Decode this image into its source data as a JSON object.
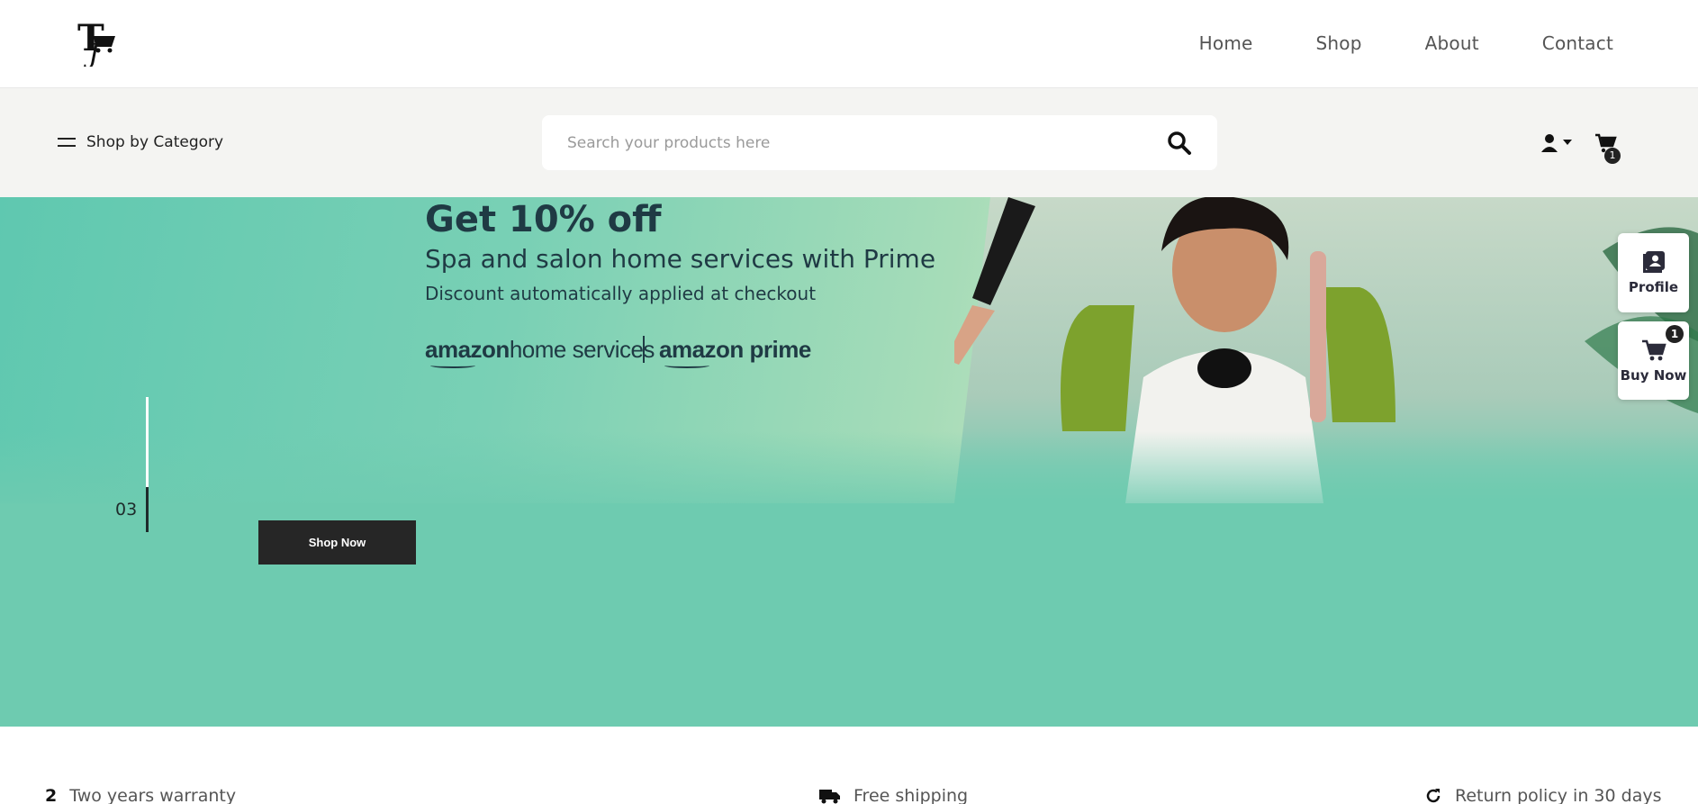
{
  "nav": {
    "logo_alt": "TJ",
    "links": [
      "Home",
      "Shop",
      "About",
      "Contact"
    ]
  },
  "toolbar": {
    "category_label": "Shop by Category",
    "search_placeholder": "Search your products here",
    "cart_count": "1"
  },
  "hero": {
    "title": "Get 10% off",
    "subtitle": "Spa and salon home services with Prime",
    "note": "Discount automatically applied at checkout",
    "brand_left_a": "amazon",
    "brand_left_b": "home services",
    "brand_right_a": "amazon",
    "brand_right_b": "prime",
    "slide_number": "03",
    "cta_label": "Shop Now"
  },
  "side_widgets": {
    "profile_label": "Profile",
    "buy_label": "Buy Now",
    "buy_count": "1"
  },
  "features": [
    {
      "num": "2",
      "label": "Two years warranty",
      "icon": "number"
    },
    {
      "label": "Free shipping",
      "icon": "truck-icon"
    },
    {
      "label": "Return policy in 30 days",
      "icon": "return-icon"
    }
  ],
  "colors": {
    "hero_bg": "#6ecbb0",
    "hero_text": "#1f3a44",
    "button_bg": "#262626",
    "band_bg": "#f4f4f2"
  }
}
